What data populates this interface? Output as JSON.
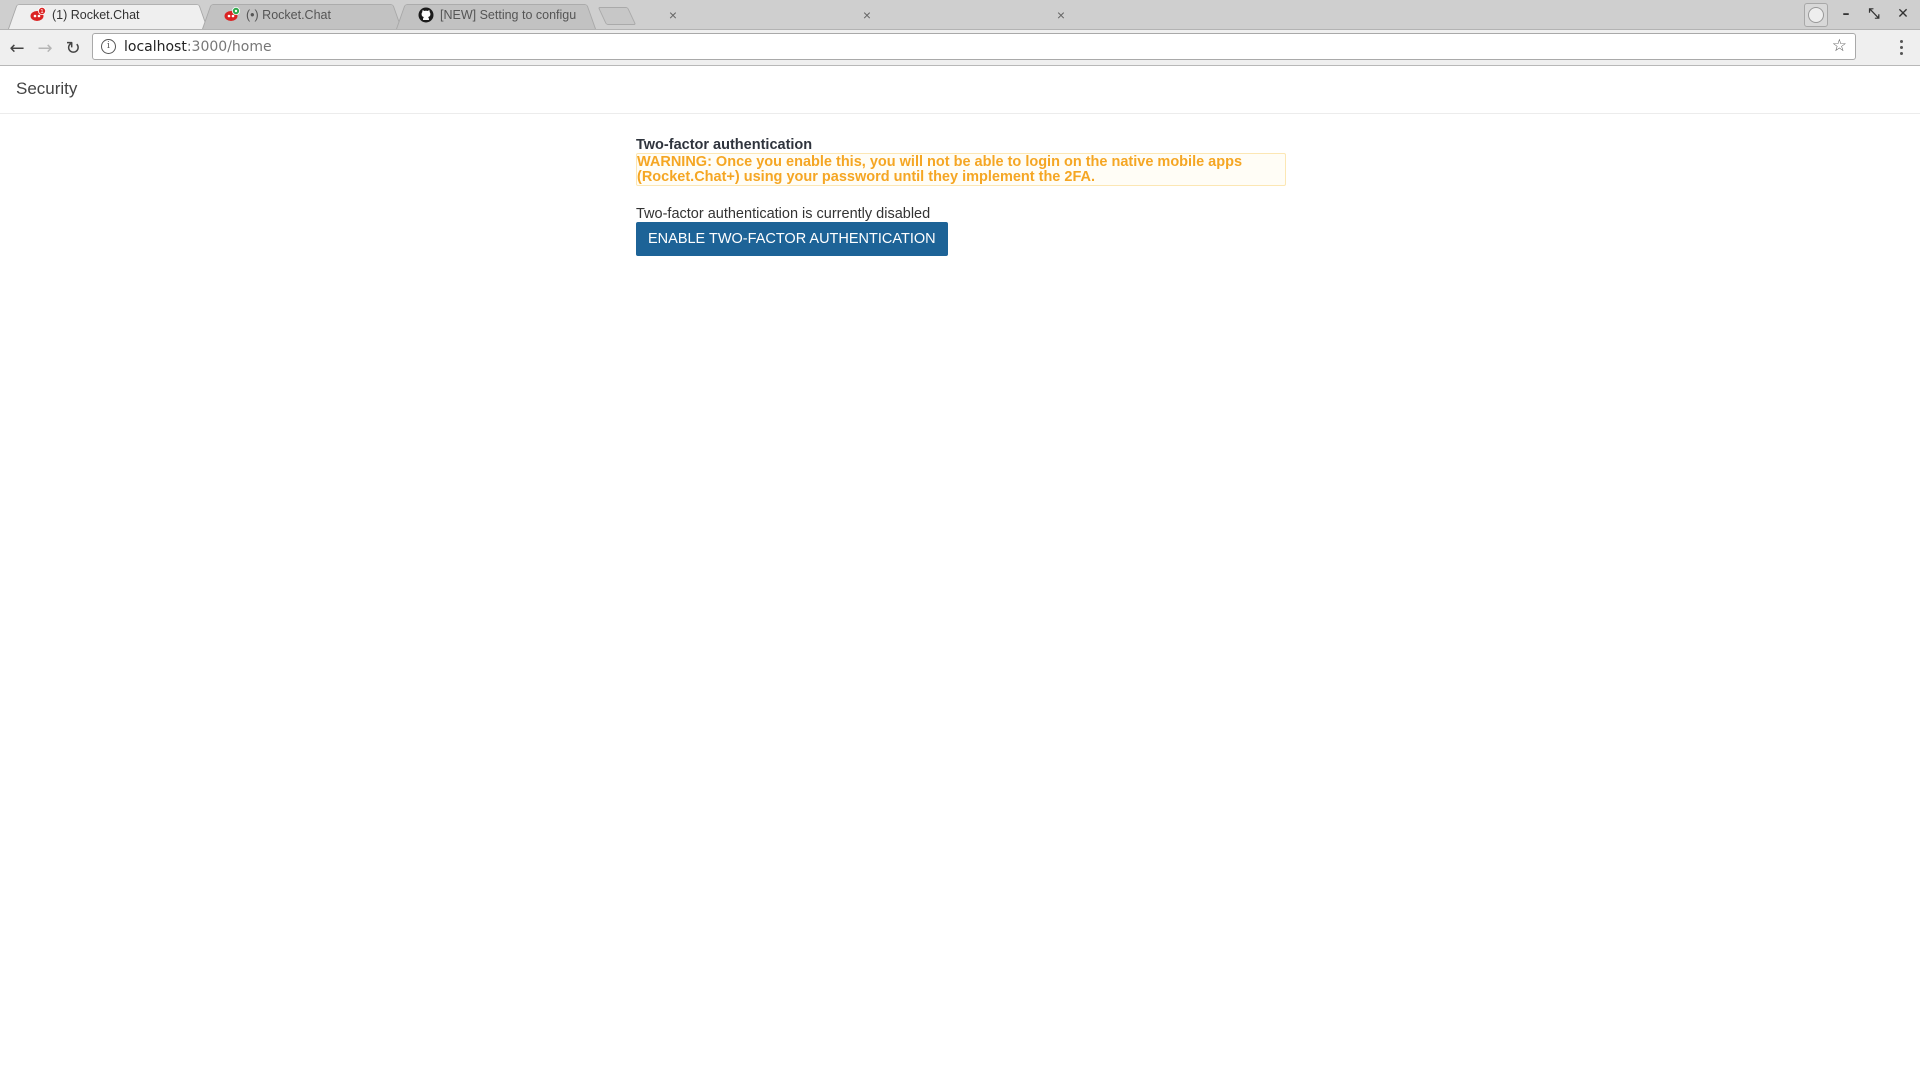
{
  "browser": {
    "tabs": [
      {
        "title": "(1) Rocket.Chat",
        "favicon": "rocket-chat-icon",
        "badge": "1",
        "active": true
      },
      {
        "title": "(•) Rocket.Chat",
        "favicon": "rocket-chat-icon",
        "badge": "•",
        "active": false
      },
      {
        "title": "[NEW] Setting to configu",
        "favicon": "github-icon",
        "active": false
      }
    ],
    "close_glyph": "×",
    "address": {
      "host": "localhost",
      "rest": ":3000/home"
    },
    "window_controls": {
      "minimize": "–",
      "restore": "⤡",
      "close": "✕"
    },
    "nav": {
      "back": "←",
      "forward": "→",
      "reload": "↻",
      "star": "☆",
      "info": "i"
    }
  },
  "page": {
    "header_title": "Security",
    "two_factor": {
      "title": "Two-factor authentication",
      "warning": "WARNING: Once you enable this, you will not be able to login on the native mobile apps (Rocket.Chat+) using your password until they implement the 2FA.",
      "status": "Two-factor authentication is currently disabled",
      "enable_button": "ENABLE TWO-FACTOR AUTHENTICATION"
    }
  },
  "colors": {
    "warning": "#f5a623",
    "primary_button": "#1d6397"
  }
}
